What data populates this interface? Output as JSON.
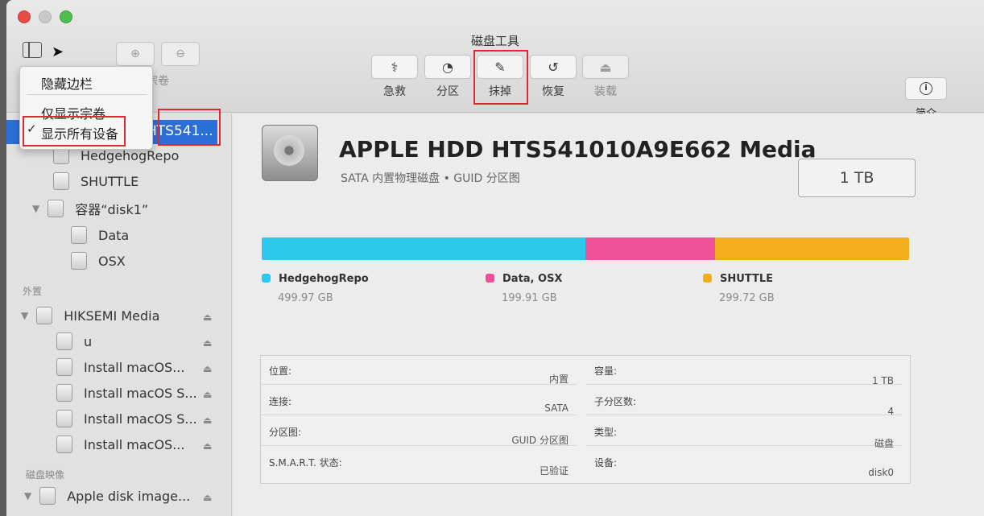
{
  "window": {
    "title": "磁盘工具"
  },
  "toolbar": {
    "volume_label": "宗卷",
    "tools": [
      {
        "label": "急救",
        "icon": "stethoscope-icon",
        "glyph": "⚕",
        "enabled": true
      },
      {
        "label": "分区",
        "icon": "pie-icon",
        "glyph": "◔",
        "enabled": true
      },
      {
        "label": "抹掉",
        "icon": "erase-icon",
        "glyph": "✎",
        "enabled": true
      },
      {
        "label": "恢复",
        "icon": "restore-icon",
        "glyph": "↺",
        "enabled": true
      },
      {
        "label": "装载",
        "icon": "mount-icon",
        "glyph": "⏏",
        "enabled": false
      }
    ],
    "info_label": "简介"
  },
  "menu": {
    "items": [
      {
        "label": "隐藏边栏",
        "checked": false
      },
      {
        "label": "仅显示宗卷",
        "checked": false
      },
      {
        "label": "显示所有设备",
        "checked": true
      }
    ],
    "checkmark": "✓"
  },
  "sidebar": {
    "selected": "HTS541...",
    "internal_items": [
      {
        "label": "HedgehogRepo"
      },
      {
        "label": "SHUTTLE"
      },
      {
        "label": "容器“disk1”"
      },
      {
        "label": "Data"
      },
      {
        "label": "OSX"
      }
    ],
    "external_header": "外置",
    "external_items": [
      {
        "label": "HIKSEMI Media"
      },
      {
        "label": "u"
      },
      {
        "label": "Install macOS..."
      },
      {
        "label": "Install macOS S..."
      },
      {
        "label": "Install macOS S..."
      },
      {
        "label": "Install macOS..."
      }
    ],
    "images_header": "磁盘映像",
    "image_items": [
      {
        "label": "Apple disk image..."
      }
    ],
    "eject_glyph": "⏏"
  },
  "disk": {
    "title": "APPLE HDD HTS541010A9E662 Media",
    "subtitle": "SATA 内置物理磁盘 • GUID 分区图",
    "capacity": "1 TB"
  },
  "usage": {
    "segments": [
      {
        "name": "HedgehogRepo",
        "size": "499.97 GB",
        "gb": 499.97,
        "color": "#2ec8ec"
      },
      {
        "name": "Data, OSX",
        "size": "199.91 GB",
        "gb": 199.91,
        "color": "#f0509a"
      },
      {
        "name": "SHUTTLE",
        "size": "299.72 GB",
        "gb": 299.72,
        "color": "#f2ae1c"
      }
    ]
  },
  "info": {
    "left": [
      {
        "key": "位置:",
        "value": "内置"
      },
      {
        "key": "连接:",
        "value": "SATA"
      },
      {
        "key": "分区图:",
        "value": "GUID 分区图"
      },
      {
        "key": "S.M.A.R.T. 状态:",
        "value": "已验证"
      }
    ],
    "right": [
      {
        "key": "容量:",
        "value": "1 TB"
      },
      {
        "key": "子分区数:",
        "value": "4"
      },
      {
        "key": "类型:",
        "value": "磁盘"
      },
      {
        "key": "设备:",
        "value": "disk0"
      }
    ]
  }
}
